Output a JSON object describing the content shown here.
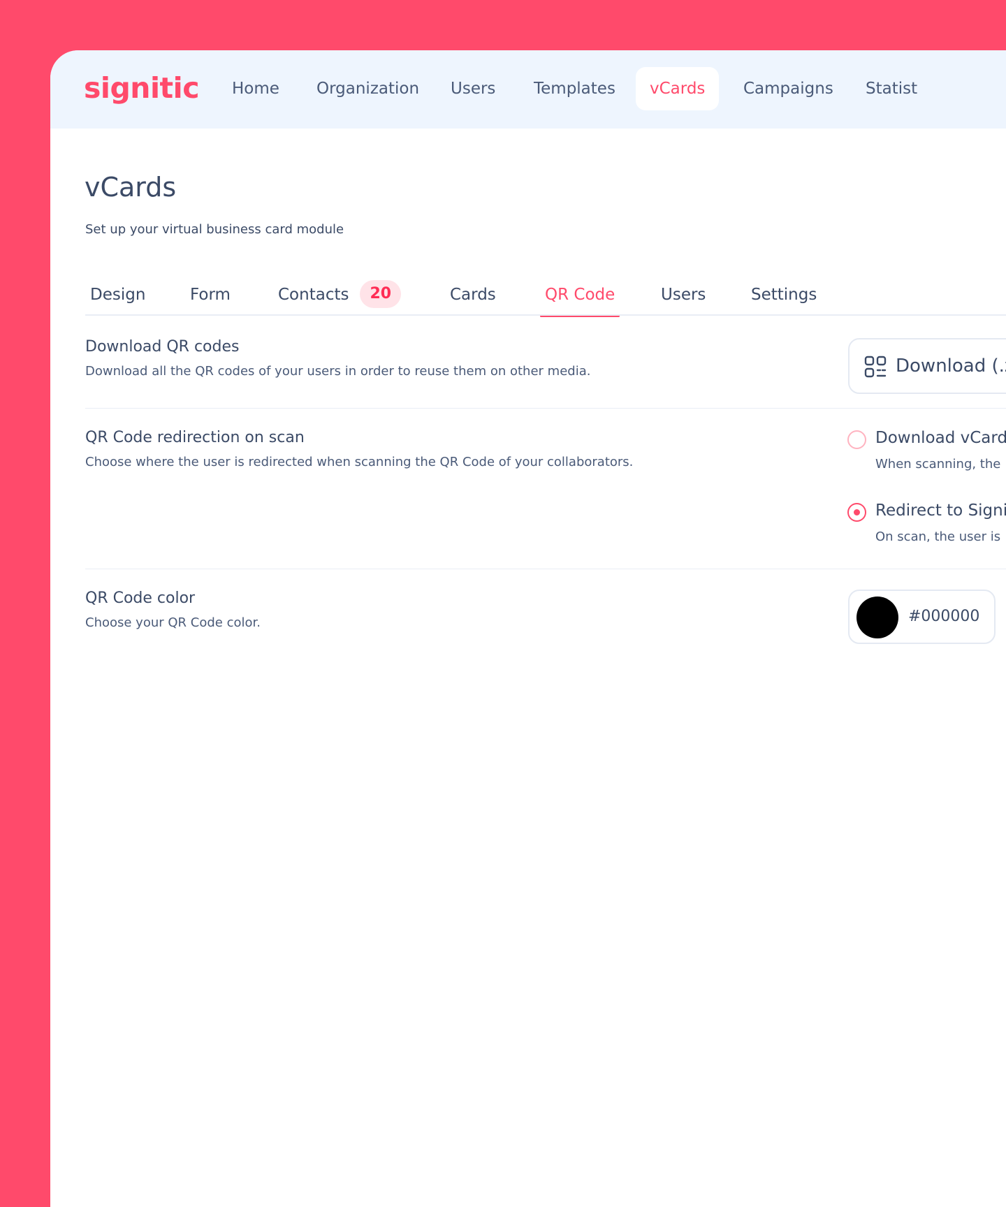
{
  "brand": {
    "logo_text": "signitic",
    "accent_color": "#ff4a6b"
  },
  "nav": {
    "items": [
      {
        "label": "Home"
      },
      {
        "label": "Organization"
      },
      {
        "label": "Users"
      },
      {
        "label": "Templates"
      },
      {
        "label": "vCards",
        "active": true
      },
      {
        "label": "Campaigns"
      },
      {
        "label": "Statist"
      }
    ]
  },
  "page": {
    "title": "vCards",
    "subtitle": "Set up your virtual business card module"
  },
  "tabs": [
    {
      "label": "Design"
    },
    {
      "label": "Form"
    },
    {
      "label": "Contacts",
      "badge": "20"
    },
    {
      "label": "Cards"
    },
    {
      "label": "QR Code",
      "active": true
    },
    {
      "label": "Users"
    },
    {
      "label": "Settings"
    }
  ],
  "sections": {
    "download": {
      "title": "Download QR codes",
      "description": "Download all the QR codes of your users in order to reuse them on other media.",
      "button_label": "Download (.z",
      "icon": "qr-code-icon"
    },
    "redirection": {
      "title": "QR Code redirection on scan",
      "description": "Choose where the user is redirected when scanning the QR Code of your collaborators.",
      "options": [
        {
          "label": "Download vCard",
          "description": "When scanning, the",
          "checked": false
        },
        {
          "label": "Redirect to Signit",
          "description": "On scan, the user is",
          "checked": true
        }
      ]
    },
    "color": {
      "title": "QR Code color",
      "description": "Choose your QR Code color.",
      "value": "#000000",
      "swatch_color": "#000000"
    }
  }
}
